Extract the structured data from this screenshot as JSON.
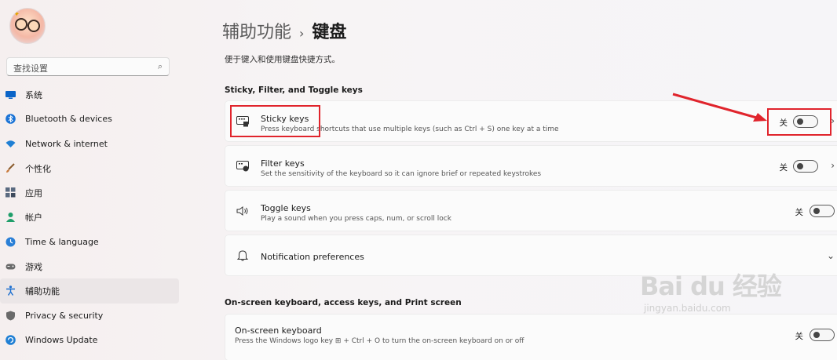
{
  "sidebar": {
    "search_placeholder": "查找设置",
    "items": [
      {
        "label": "系统",
        "icon": "monitor-icon",
        "color": "#0a64c8"
      },
      {
        "label": "Bluetooth & devices",
        "icon": "bluetooth-icon",
        "color": "#1a73d6"
      },
      {
        "label": "Network & internet",
        "icon": "wifi-icon",
        "color": "#1f7fd4"
      },
      {
        "label": "个性化",
        "icon": "brush-icon",
        "color": "#c97a3c"
      },
      {
        "label": "应用",
        "icon": "apps-icon",
        "color": "#5a6a80"
      },
      {
        "label": "帐户",
        "icon": "person-icon",
        "color": "#1f9e6a"
      },
      {
        "label": "Time & language",
        "icon": "globe-clock-icon",
        "color": "#2a7fd6"
      },
      {
        "label": "游戏",
        "icon": "gamepad-icon",
        "color": "#6a6a6a"
      },
      {
        "label": "辅助功能",
        "icon": "accessibility-icon",
        "color": "#1c6fd0"
      },
      {
        "label": "Privacy & security",
        "icon": "shield-icon",
        "color": "#6a6a6a"
      },
      {
        "label": "Windows Update",
        "icon": "update-icon",
        "color": "#1f7fd4"
      }
    ],
    "active_index": 8
  },
  "header": {
    "parent": "辅助功能",
    "separator": "›",
    "current": "键盘"
  },
  "description": "便于键入和使用键盘快捷方式。",
  "section1": {
    "title": "Sticky, Filter, and Toggle keys",
    "cards": [
      {
        "title": "Sticky keys",
        "subtitle": "Press keyboard shortcuts that use multiple keys (such as Ctrl + S) one key at a time",
        "state": "关",
        "icon": "sticky-keys-icon"
      },
      {
        "title": "Filter keys",
        "subtitle": "Set the sensitivity of the keyboard so it can ignore brief or repeated keystrokes",
        "state": "关",
        "icon": "filter-keys-icon"
      },
      {
        "title": "Toggle keys",
        "subtitle": "Play a sound when you press caps, num, or scroll lock",
        "state": "关",
        "icon": "speaker-icon"
      },
      {
        "title": "Notification preferences",
        "icon": "bell-icon"
      }
    ]
  },
  "section2": {
    "title": "On-screen keyboard, access keys, and Print screen",
    "cards": [
      {
        "title": "On-screen keyboard",
        "subtitle": "Press the Windows logo key ⊞ + Ctrl + O to turn the on-screen keyboard on or off",
        "state": "关"
      }
    ]
  },
  "watermark": {
    "big": "Bai du 经验",
    "small": "jingyan.baidu.com"
  },
  "colors": {
    "highlight": "#e0242c",
    "active_nav": "#ebe6e7"
  }
}
